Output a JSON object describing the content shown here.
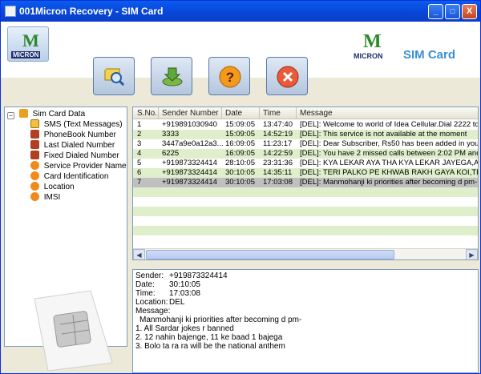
{
  "window": {
    "title": "001Micron Recovery - SIM Card",
    "minimize": "_",
    "maximize": "□",
    "close": "X"
  },
  "header": {
    "logo_left_text": "MICRON",
    "logo_right_text": "MICRON",
    "product_title": "SIM Card"
  },
  "tree": {
    "root": "Sim Card Data",
    "items": [
      "SMS (Text Messages)",
      "PhoneBook Number",
      "Last Dialed Number",
      "Fixed Dialed Number",
      "Service Provider Name",
      "Card Identification",
      "Location",
      "IMSI"
    ]
  },
  "grid": {
    "columns": [
      "S.No.",
      "Sender Number",
      "Date",
      "Time",
      "Message"
    ],
    "rows": [
      [
        "1",
        "+919891030940",
        "15:09:05",
        "13:47:40",
        "[DEL]: Welcome to world of Idea Cellular.Dial 2222 to recha"
      ],
      [
        "2",
        "3333",
        "15:09:05",
        "14:52:19",
        "[DEL]: This service is not available at the moment"
      ],
      [
        "3",
        "3447a9e0a12a3...",
        "16:09:05",
        "11:23:17",
        "[DEL]: Dear Subscriber, Rs50 has been added in your acco"
      ],
      [
        "4",
        "6225",
        "16:09:05",
        "14:22:59",
        "[DEL]: You have 2 missed calls between 2:02 PM and 2:23"
      ],
      [
        "5",
        "+919873324414",
        "28:10:05",
        "23:31:36",
        "[DEL]: KYA LEKAR AYA THA KYA LEKAR JAYEGA,AE NA"
      ],
      [
        "6",
        "+919873324414",
        "30:10:05",
        "14:35:11",
        "[DEL]: TERI PALKO PE KHWAB RAKH GAYA KOI,TERI Sa"
      ],
      [
        "7",
        "+919873324414",
        "30:10:05",
        "17:03:08",
        "[DEL]: Manmohanji ki priorities after becoming d pm-|1. All Sa"
      ]
    ]
  },
  "detail": {
    "sender_label": "Sender:",
    "sender": "+919873324414",
    "date_label": "Date:",
    "date": "30:10:05",
    "time_label": "Time:",
    "time": "17:03:08",
    "location_label": "Location:",
    "location": "DEL",
    "message_label": "Message:",
    "message_lines": [
      "Manmohanji ki priorities after becoming d pm-",
      "1. All Sardar jokes r banned",
      "2. 12 nahin bajenge, 11 ke baad 1 bajega",
      "3. Bolo ta ra ra will be the national anthem"
    ]
  },
  "toolbar": {
    "icons": [
      "search-icon",
      "save-icon",
      "help-icon",
      "exit-icon"
    ]
  },
  "colors": {
    "row_even": "#dfeecb",
    "row_odd": "#ffffff",
    "row_selected": "#c0c0c0",
    "brand": "#3a8fd4"
  }
}
